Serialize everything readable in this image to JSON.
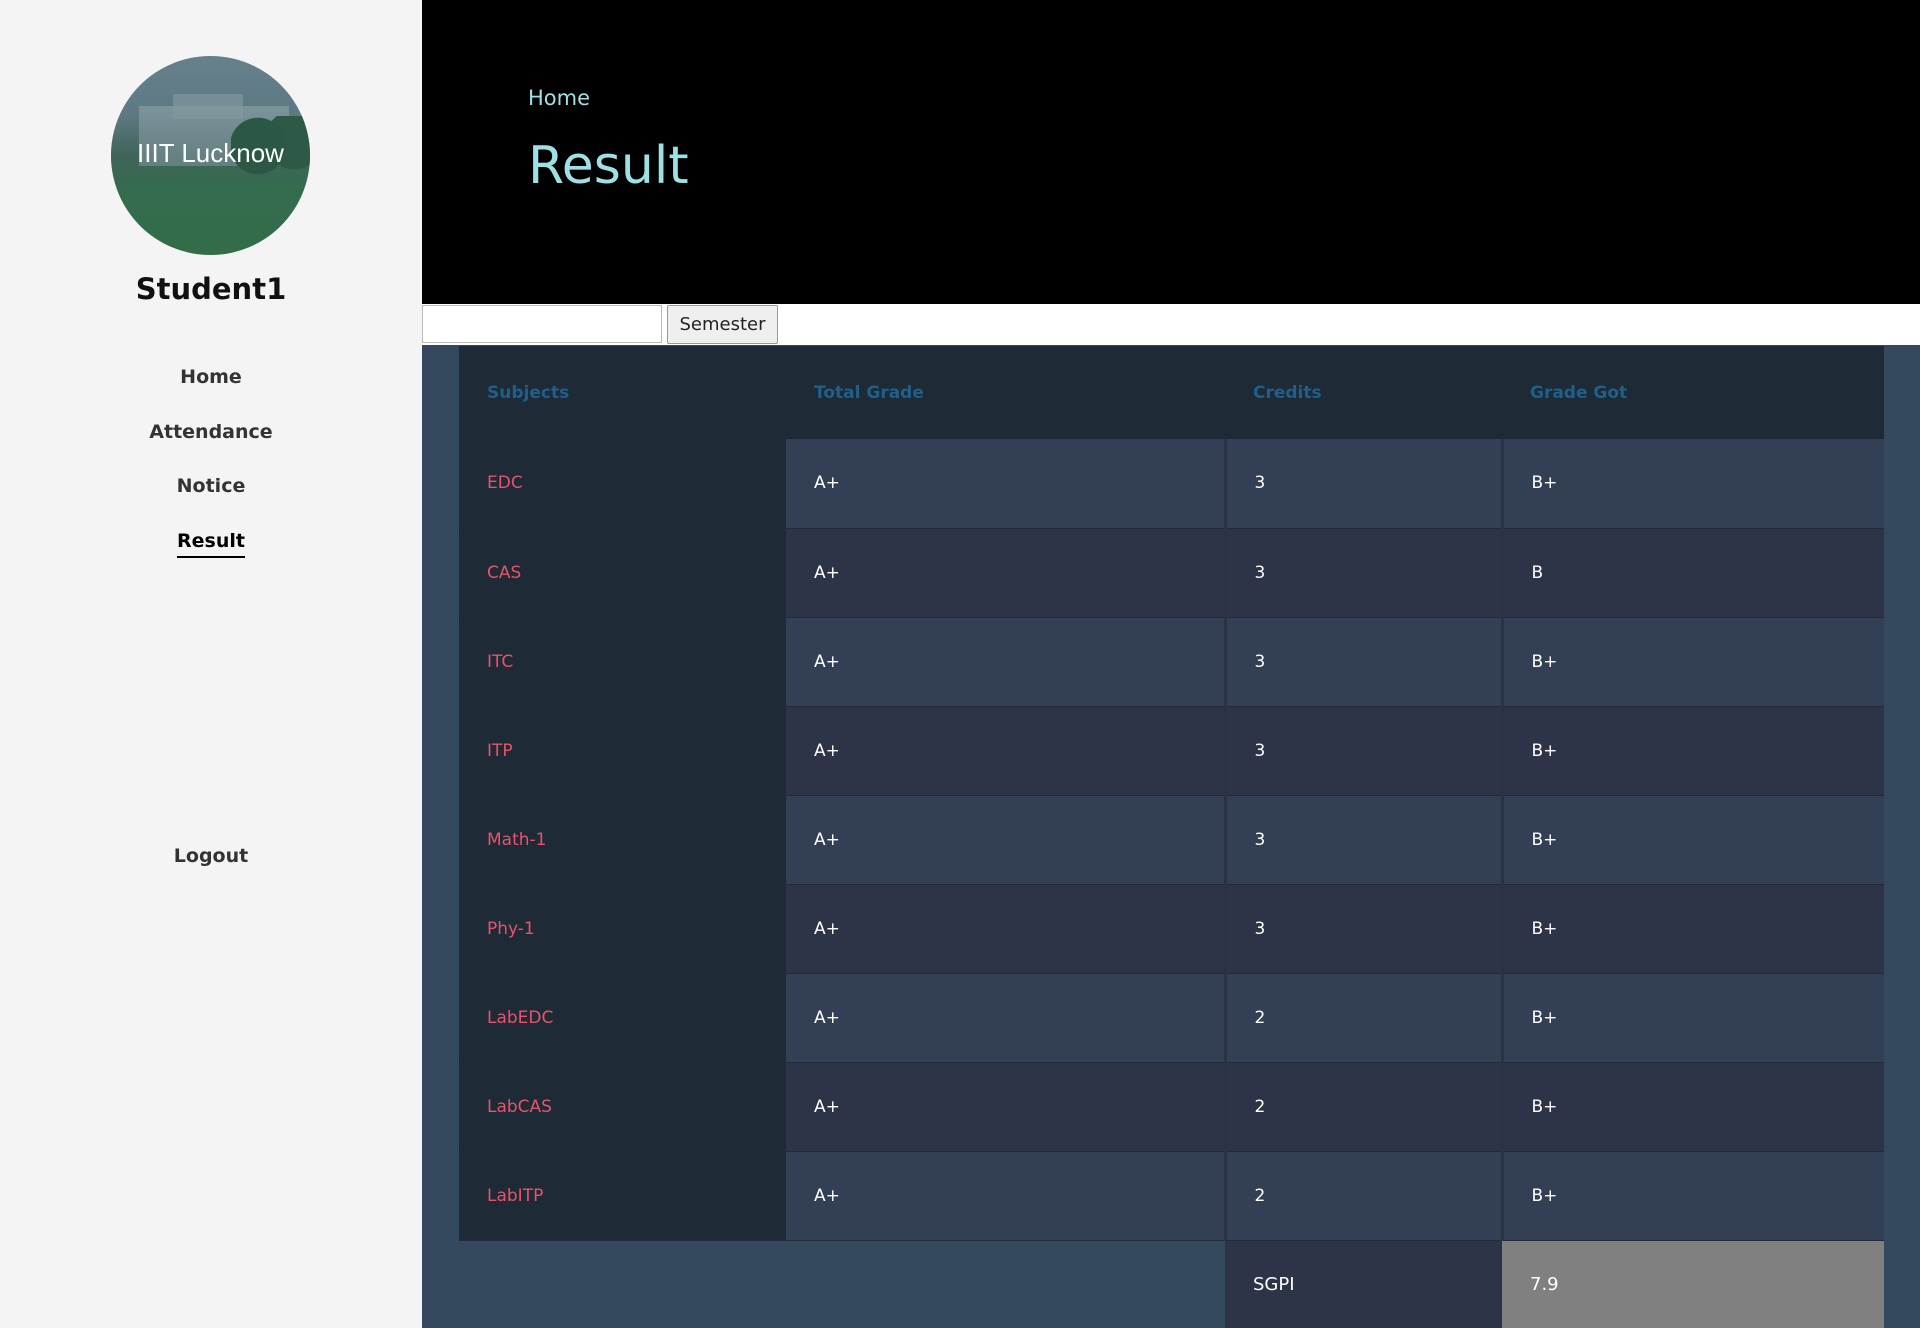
{
  "sidebar": {
    "avatar_label": "IIIT Lucknow",
    "student_name": "Student1",
    "nav": [
      {
        "label": "Home"
      },
      {
        "label": "Attendance"
      },
      {
        "label": "Notice"
      },
      {
        "label": "Result"
      }
    ],
    "active_item": "Result",
    "logout_label": "Logout"
  },
  "header": {
    "breadcrumb": "Home",
    "title": "Result"
  },
  "semester": {
    "input_value": "",
    "button_label": "Semester"
  },
  "table": {
    "columns": [
      "Subjects",
      "Total Grade",
      "Credits",
      "Grade Got"
    ],
    "rows": [
      {
        "subject": "EDC",
        "total_grade": "A+",
        "credits": "3",
        "grade_got": "B+"
      },
      {
        "subject": "CAS",
        "total_grade": "A+",
        "credits": "3",
        "grade_got": "B"
      },
      {
        "subject": "ITC",
        "total_grade": "A+",
        "credits": "3",
        "grade_got": "B+"
      },
      {
        "subject": "ITP",
        "total_grade": "A+",
        "credits": "3",
        "grade_got": "B+"
      },
      {
        "subject": "Math-1",
        "total_grade": "A+",
        "credits": "3",
        "grade_got": "B+"
      },
      {
        "subject": "Phy-1",
        "total_grade": "A+",
        "credits": "3",
        "grade_got": "B+"
      },
      {
        "subject": "LabEDC",
        "total_grade": "A+",
        "credits": "2",
        "grade_got": "B+"
      },
      {
        "subject": "LabCAS",
        "total_grade": "A+",
        "credits": "2",
        "grade_got": "B+"
      },
      {
        "subject": "LabITP",
        "total_grade": "A+",
        "credits": "2",
        "grade_got": "B+"
      }
    ],
    "summary_label": "SGPI",
    "summary_value": "7.9"
  },
  "colors": {
    "accent_title": "#9de0e6",
    "subject_text": "#e8536b",
    "header_text": "#1f5f8b",
    "page_bg": "#34495e",
    "sidebar_bg": "#f4f4f4"
  }
}
